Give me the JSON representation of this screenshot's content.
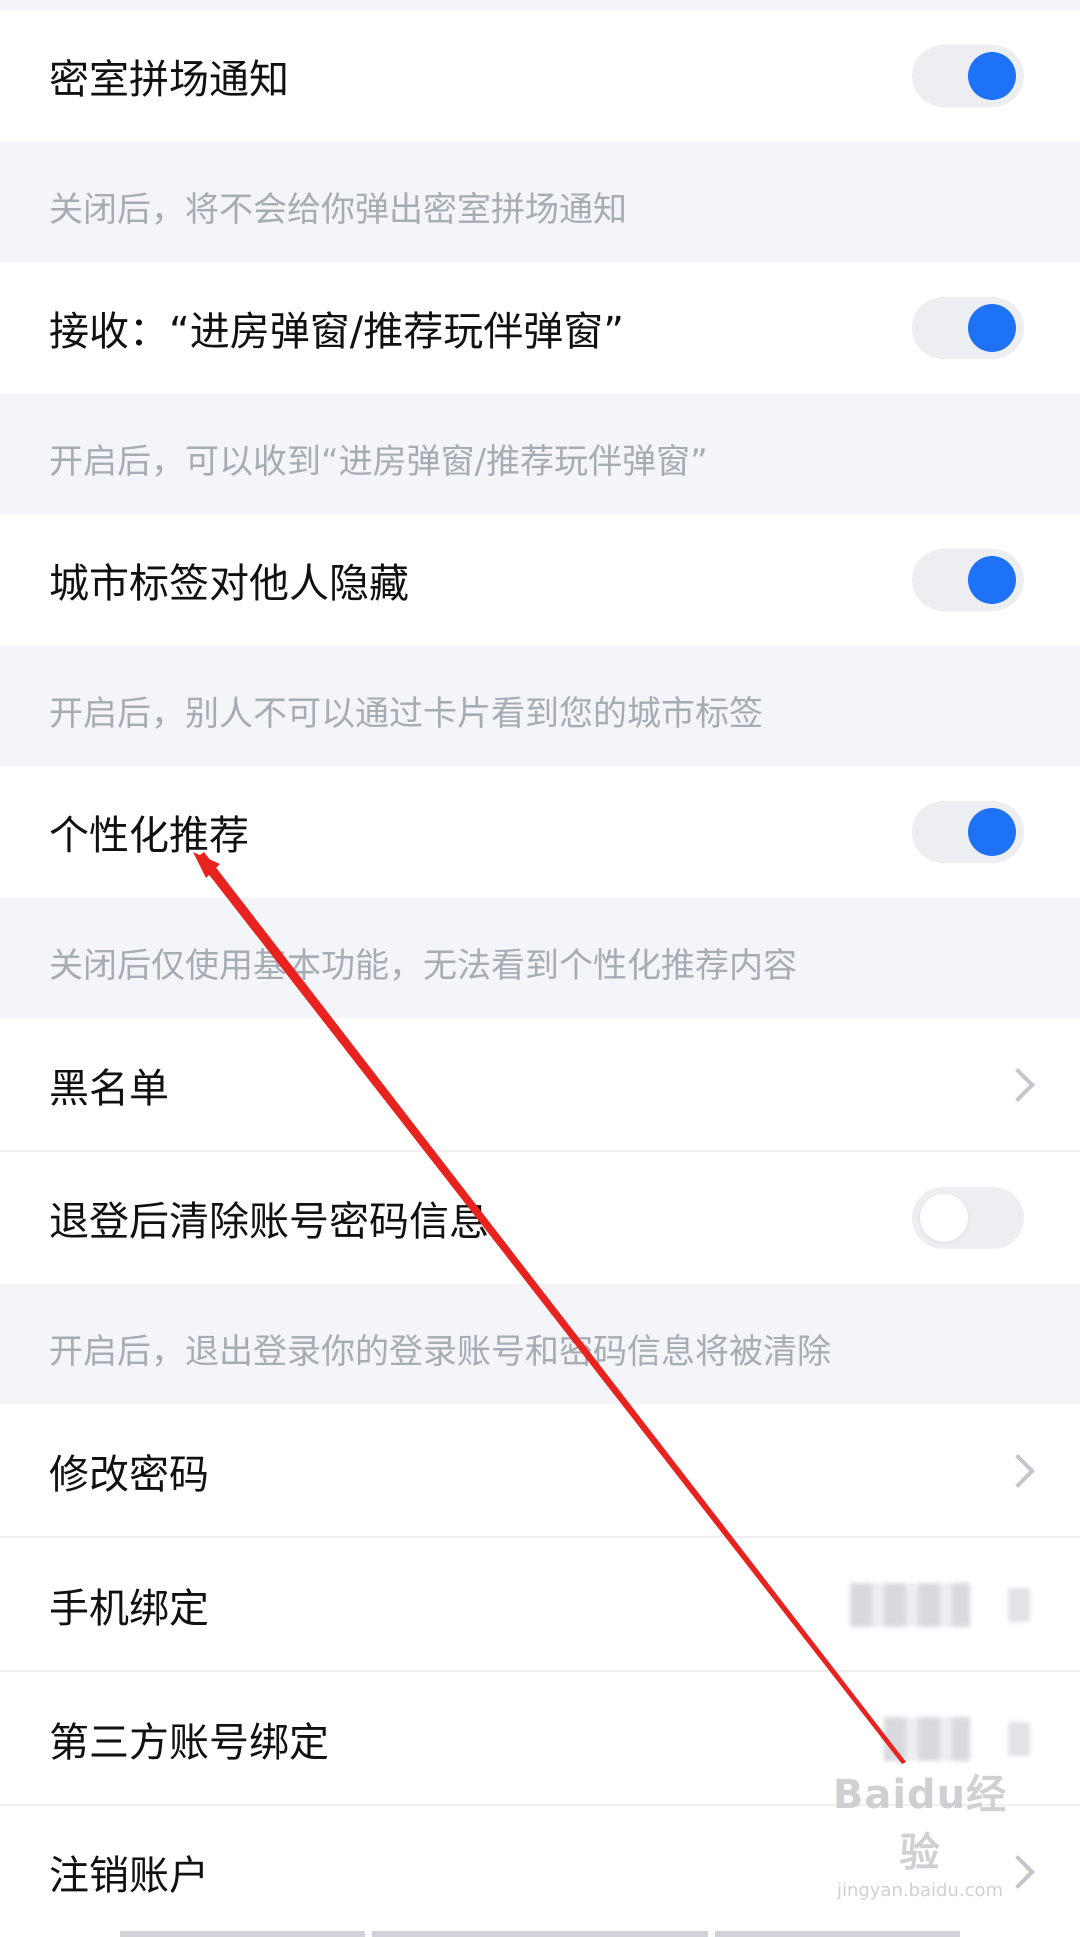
{
  "settings": {
    "escape_notice": {
      "title": "密室拼场通知",
      "hint": "关闭后，将不会给你弹出密室拼场通知",
      "toggle_on": true
    },
    "receive_popup": {
      "title": "接收：“进房弹窗/推荐玩伴弹窗”",
      "hint": "开启后，可以收到“进房弹窗/推荐玩伴弹窗”",
      "toggle_on": true
    },
    "city_tag": {
      "title": "城市标签对他人隐藏",
      "hint": "开启后，别人不可以通过卡片看到您的城市标签",
      "toggle_on": true
    },
    "personalized": {
      "title": "个性化推荐",
      "hint": "关闭后仅使用基本功能，无法看到个性化推荐内容",
      "toggle_on": true
    },
    "blacklist": {
      "title": "黑名单"
    },
    "clear_on_logout": {
      "title": "退登后清除账号密码信息",
      "hint": "开启后，退出登录你的登录账号和密码信息将被清除",
      "toggle_on": false
    },
    "change_password": {
      "title": "修改密码"
    },
    "phone_binding": {
      "title": "手机绑定"
    },
    "third_party": {
      "title": "第三方账号绑定"
    },
    "cancel_account": {
      "title": "注销账户"
    }
  },
  "colors": {
    "accent": "#1e72f5",
    "hint_text": "#a7abb4",
    "annotation_arrow": "#e8231f"
  },
  "icons": {
    "chevron": "chevron-right-icon",
    "toggle": "toggle-switch"
  },
  "watermark": {
    "brand": "Baidu经验",
    "site": "jingyan.baidu.com"
  }
}
